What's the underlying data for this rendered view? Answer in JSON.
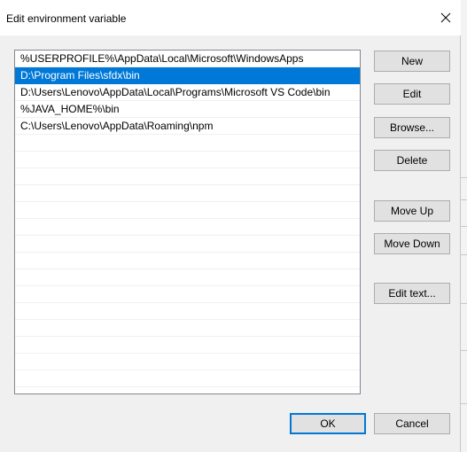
{
  "window": {
    "title": "Edit environment variable"
  },
  "paths": [
    "%USERPROFILE%\\AppData\\Local\\Microsoft\\WindowsApps",
    "D:\\Program Files\\sfdx\\bin",
    "D:\\Users\\Lenovo\\AppData\\Local\\Programs\\Microsoft VS Code\\bin",
    "%JAVA_HOME%\\bin",
    "C:\\Users\\Lenovo\\AppData\\Roaming\\npm",
    "",
    "",
    "",
    "",
    "",
    "",
    "",
    "",
    "",
    "",
    "",
    "",
    "",
    "",
    "",
    ""
  ],
  "selected_index": 1,
  "buttons": {
    "new": "New",
    "edit": "Edit",
    "browse": "Browse...",
    "delete": "Delete",
    "move_up": "Move Up",
    "move_down": "Move Down",
    "edit_text": "Edit text...",
    "ok": "OK",
    "cancel": "Cancel"
  },
  "colors": {
    "selection": "#0078d7",
    "default_button_border": "#0078d7"
  },
  "icons": {
    "close": "close-icon"
  }
}
